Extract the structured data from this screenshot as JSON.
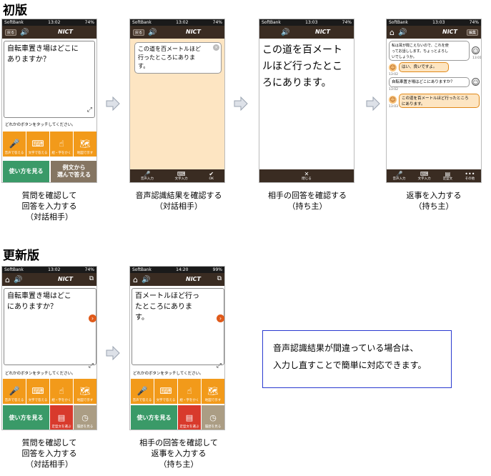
{
  "sections": {
    "original": "初版",
    "updated": "更新版"
  },
  "status": {
    "carrier": "SoftBank",
    "battery": "74%",
    "battery_alt": "99%",
    "time1": "13:02",
    "time3": "13:03",
    "time_u2": "14:20"
  },
  "nav": {
    "back": "戻る",
    "nict": "NICT",
    "edit": "編集"
  },
  "prompt": "どれかのボタンをタッチしてください。",
  "buttons": {
    "voice": "音声で答える",
    "text": "文字で答える",
    "handwrite": "絵・字をかく",
    "map": "地図で示す",
    "howto": "使い方を見る",
    "example_l1": "例文から",
    "example_l2": "選んで答える",
    "template": "定型文を選ぶ",
    "history": "履歴を見る"
  },
  "toolbar": {
    "voice_input": "音声入力",
    "text_input": "文字入力",
    "ok": "OK",
    "close": "閉じる",
    "template": "定型文",
    "more": "その他"
  },
  "screens": {
    "p1": {
      "question_l1": "自転車置き場はどこに",
      "question_l2": "ありますか？"
    },
    "p2": {
      "result_l1": "この道を百メートルほど",
      "result_l2": "行ったところにありま",
      "result_l3": "す。"
    },
    "p3": {
      "answer_l1": "この道を百メート",
      "answer_l2": "ルほど行ったとこ",
      "answer_l3": "ろにあります。"
    },
    "p4": {
      "m1_l1": "私は耳が聞こえないので、これを使",
      "m1_l2": "ってお話しします。ちょっとよろし",
      "m1_l3": "いでしょうか。",
      "m1_time": "13:01",
      "m2": "はい、良いですよ。",
      "m2_time": "13:02",
      "m3": "自転車置き場はどこにありますか？",
      "m3_time": "13:02",
      "m4_l1": "この道を百メートルほど行ったところ",
      "m4_l2": "にあります。",
      "m4_time": "13:03"
    },
    "u1": {
      "question_l1": "自転車置き場はどこ",
      "question_l2": "にありますか？"
    },
    "u2": {
      "text_l1": "百メートルほど行っ",
      "text_l2": "たところにありま",
      "text_l3": "す。"
    }
  },
  "captions": {
    "c1": [
      "質問を確認して",
      "回答を入力する",
      "（対話相手）"
    ],
    "c2": [
      "音声認識結果を確認する",
      "（対話相手）"
    ],
    "c3": [
      "相手の回答を確認する",
      "（持ち主）"
    ],
    "c4": [
      "返事を入力する",
      "（持ち主）"
    ],
    "c5": [
      "質問を確認して",
      "回答を入力する",
      "（対話相手）"
    ],
    "c6": [
      "相手の回答を確認して",
      "返事を入力する",
      "（持ち主）"
    ]
  },
  "note": {
    "l1": "音声認識結果が間違っている場合は、",
    "l2": "入力し直すことで簡単に対応できます。"
  },
  "colors": {
    "orange": "#f29a1a",
    "green": "#3a9a68",
    "nav": "#3a2c22",
    "peach": "#fde5c2",
    "note_border": "#2a3ad0"
  }
}
